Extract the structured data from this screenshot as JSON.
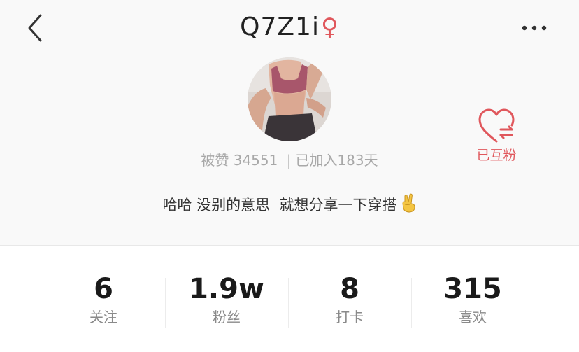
{
  "header": {
    "title": "Q7Z1i",
    "gender_symbol": "♀",
    "back_icon": "chevron-left-icon",
    "more_icon": "more-horizontal-icon"
  },
  "profile": {
    "likes_label": "被赞",
    "likes_count": "34551",
    "separator": "|",
    "joined_text": "已加入183天",
    "bio_text": "哈哈 没别的意思  就想分享一下穿搭",
    "bio_emoji": "victory-hand-icon",
    "follow_status": "已互粉"
  },
  "stats": [
    {
      "value": "6",
      "label": "关注"
    },
    {
      "value": "1.9w",
      "label": "粉丝"
    },
    {
      "value": "8",
      "label": "打卡"
    },
    {
      "value": "315",
      "label": "喜欢"
    }
  ],
  "colors": {
    "accent": "#e0575c",
    "text_primary": "#222222",
    "text_muted": "#a8a8a8",
    "background": "#f9f9f9"
  }
}
